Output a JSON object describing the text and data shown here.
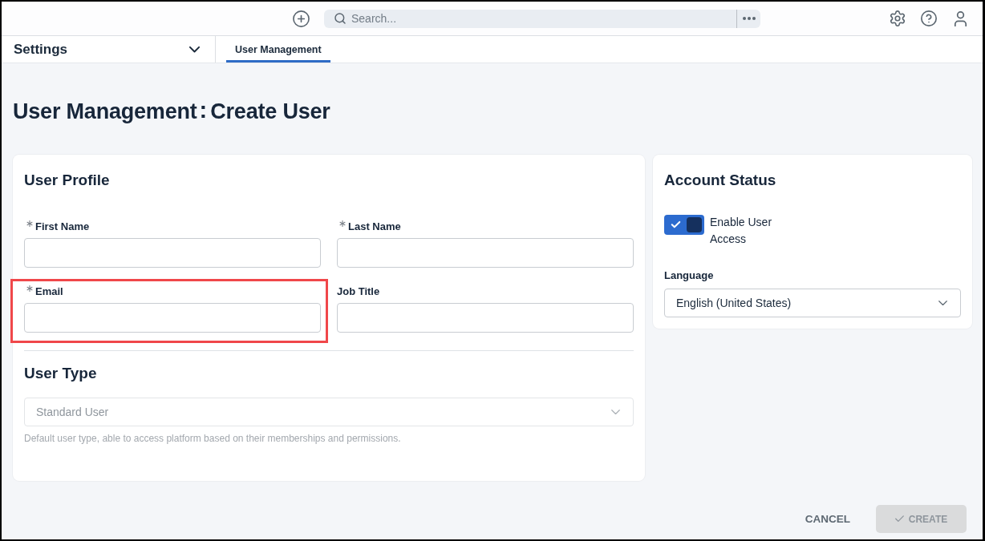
{
  "top_bar": {
    "search": {
      "placeholder": "Search..."
    }
  },
  "nav": {
    "section": "Settings",
    "tabs": [
      {
        "label": "User Management",
        "selected": true
      }
    ]
  },
  "page_title": {
    "parent": "User Management",
    "separator": ":",
    "current": "Create User"
  },
  "user_profile": {
    "title": "User Profile",
    "fields": [
      {
        "label": "First Name",
        "required": true,
        "highlighted": false
      },
      {
        "label": "Last Name",
        "required": true,
        "highlighted": false
      },
      {
        "label": "Email",
        "required": true,
        "highlighted": true
      },
      {
        "label": "Job Title",
        "required": false,
        "highlighted": false
      }
    ]
  },
  "user_type": {
    "title": "User Type",
    "select": {
      "value": "Standard User",
      "disabled": true
    },
    "hint": "Default user type, able to access platform based on their memberships and permissions."
  },
  "account_status": {
    "title": "Account Status",
    "toggle": {
      "label": "Enable User Access",
      "on": true
    },
    "language": {
      "label": "Language",
      "value": "English (United States)"
    }
  },
  "actions": {
    "cancel": "CANCEL",
    "create": {
      "label": "CREATE",
      "disabled": true
    }
  }
}
